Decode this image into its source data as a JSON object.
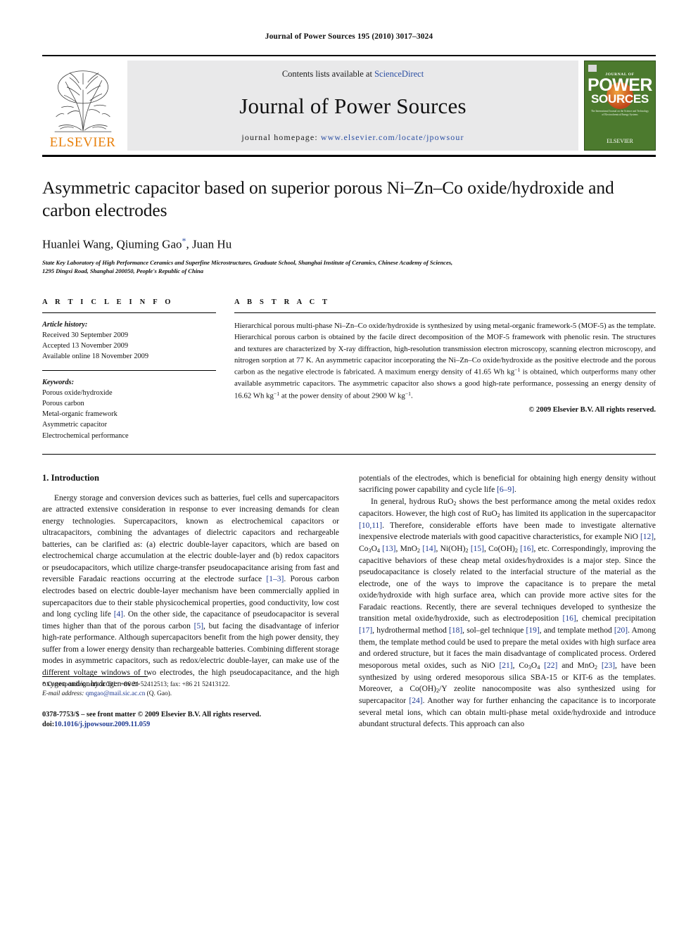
{
  "running_head": "Journal of Power Sources 195 (2010) 3017–3024",
  "masthead": {
    "contents_prefix": "Contents lists available at ",
    "contents_link": "ScienceDirect",
    "journal_title": "Journal of Power Sources",
    "homepage_prefix": "journal homepage: ",
    "homepage_url": "www.elsevier.com/locate/jpowsour",
    "publisher_name": "ELSEVIER",
    "cover": {
      "top_label": "JOURNAL OF",
      "line1": "POWER",
      "line2": "SOURCES",
      "blurb": "The International Journal on the Science and Technology of Electrochemical Energy Systems",
      "bottom_mark": "ELSEVIER"
    }
  },
  "article": {
    "title": "Asymmetric capacitor based on superior porous Ni–Zn–Co oxide/hydroxide and carbon electrodes",
    "authors": "Huanlei Wang, Qiuming Gao",
    "authors_tail": ", Juan Hu",
    "corresponding_mark": "*",
    "affiliation_line1": "State Key Laboratory of High Performance Ceramics and Superfine Microstructures, Graduate School, Shanghai Institute of Ceramics, Chinese Academy of Sciences,",
    "affiliation_line2": "1295 Dingxi Road, Shanghai 200050, People's Republic of China"
  },
  "article_info": {
    "heading": "A R T I C L E    I N F O",
    "history_title": "Article history:",
    "history": [
      "Received 30 September 2009",
      "Accepted 13 November 2009",
      "Available online 18 November 2009"
    ],
    "keywords_title": "Keywords:",
    "keywords": [
      "Porous oxide/hydroxide",
      "Porous carbon",
      "Metal-organic framework",
      "Asymmetric capacitor",
      "Electrochemical performance"
    ]
  },
  "abstract": {
    "heading": "A B S T R A C T",
    "text_part1": "Hierarchical porous multi-phase Ni–Zn–Co oxide/hydroxide is synthesized by using metal-organic framework-5 (MOF-5) as the template. Hierarchical porous carbon is obtained by the facile direct decomposition of the MOF-5 framework with phenolic resin. The structures and textures are characterized by X-ray diffraction, high-resolution transmission electron microscopy, scanning electron microscopy, and nitrogen sorption at 77 K. An asymmetric capacitor incorporating the Ni–Zn–Co oxide/hydroxide as the positive electrode and the porous carbon as the negative electrode is fabricated. A maximum energy density of 41.65 Wh kg",
    "sup1": "−1",
    "text_part2": " is obtained, which outperforms many other available asymmetric capacitors. The asymmetric capacitor also shows a good high-rate performance, possessing an energy density of 16.62 Wh kg",
    "sup2": "−1",
    "text_part3": " at the power density of about 2900 W kg",
    "sup3": "−1",
    "text_part4": ".",
    "copyright": "© 2009 Elsevier B.V. All rights reserved."
  },
  "introduction": {
    "heading": "1.  Introduction",
    "left": {
      "p1_a": "Energy storage and conversion devices such as batteries, fuel cells and supercapacitors are attracted extensive consideration in response to ever increasing demands for clean energy technologies. Supercapacitors, known as electrochemical capacitors or ultracapacitors, combining the advantages of dielectric capacitors and rechargeable batteries, can be clarified as: (a) electric double-layer capacitors, which are based on electrochemical charge accumulation at the electric double-layer and (b) redox capacitors or pseudocapacitors, which utilize charge-transfer pseudocapacitance arising from fast and reversible Faradaic reactions occurring at the electrode surface ",
      "ref1": "[1–3]",
      "p1_b": ". Porous carbon electrodes based on electric double-layer mechanism have been commercially applied in supercapacitors due to their stable physicochemical properties, good conductivity, low cost and long cycling life ",
      "ref2": "[4]",
      "p1_c": ". On the other side, the capacitance of pseudocapacitor is several times higher than that of the porous carbon ",
      "ref3": "[5]",
      "p1_d": ", but facing the disadvantage of inferior high-rate performance. Although supercapacitors benefit from the high power density, they suffer from a lower energy density than rechargeable batteries. Combining different storage modes in asymmetric capacitors, such as redox/electric double-layer, can make use of the different voltage windows of two electrodes, the high pseudocapacitance, and the high oxygen and/or hydrogen over-"
    },
    "right": {
      "p1_a": "potentials of the electrodes, which is beneficial for obtaining high energy density without sacrificing power capability and cycle life ",
      "ref1": "[6–9]",
      "p1_b": ".",
      "p2_a": "In general, hydrous RuO",
      "sub1": "2",
      "p2_b": " shows the best performance among the metal oxides redox capacitors. However, the high cost of RuO",
      "sub2": "2",
      "p2_c": " has limited its application in the supercapacitor ",
      "ref2": "[10,11]",
      "p2_d": ". Therefore, considerable efforts have been made to investigate alternative inexpensive electrode materials with good capacitive characteristics, for example NiO ",
      "ref3": "[12]",
      "p2_e": ", Co",
      "sub3": "3",
      "p2_f": "O",
      "sub4": "4",
      "p2_g": " ",
      "ref4": "[13]",
      "p2_h": ", MnO",
      "sub5": "2",
      "p2_i": " ",
      "ref5": "[14]",
      "p2_j": ", Ni(OH)",
      "sub6": "2",
      "p2_k": " ",
      "ref6": "[15]",
      "p2_l": ", Co(OH)",
      "sub7": "2",
      "p2_m": " ",
      "ref7": "[16]",
      "p2_n": ", etc. Correspondingly, improving the capacitive behaviors of these cheap metal oxides/hydroxides is a major step. Since the pseudocapacitance is closely related to the interfacial structure of the material as the electrode, one of the ways to improve the capacitance is to prepare the metal oxide/hydroxide with high surface area, which can provide more active sites for the Faradaic reactions. Recently, there are several techniques developed to synthesize the transition metal oxide/hydroxide, such as electrodeposition ",
      "ref8": "[16]",
      "p2_o": ", chemical precipitation ",
      "ref9": "[17]",
      "p2_p": ", hydrothermal method ",
      "ref10": "[18]",
      "p2_q": ", sol–gel technique ",
      "ref11": "[19]",
      "p2_r": ", and template method ",
      "ref12": "[20]",
      "p2_s": ". Among them, the template method could be used to prepare the metal oxides with high surface area and ordered structure, but it faces the main disadvantage of complicated process. Ordered mesoporous metal oxides, such as NiO ",
      "ref13": "[21]",
      "p2_t": ", Co",
      "sub8": "3",
      "p2_u": "O",
      "sub9": "4",
      "p2_v": " ",
      "ref14": "[22]",
      "p2_w": " and MnO",
      "sub10": "2",
      "p2_x": " ",
      "ref15": "[23]",
      "p2_y": ", have been synthesized by using ordered mesoporous silica SBA-15 or KIT-6 as the templates. Moreover, a Co(OH)",
      "sub11": "2",
      "p2_z": "/Y zeolite nanocomposite was also synthesized using for supercapacitor ",
      "ref16": "[24]",
      "p2_aa": ". Another way for further enhancing the capacitance is to incorporate several metal ions, which can obtain multi-phase metal oxide/hydroxide and introduce abundant structural defects. This approach can also"
    }
  },
  "footnote": {
    "line1": "*  Corresponding author. Tel.: +86 21 52412513; fax: +86 21 52413122.",
    "line2_label": "E-mail address:",
    "line2_mail": " qmgao@mail.sic.ac.cn",
    "line2_tail": " (Q. Gao).",
    "issn_line": "0378-7753/$ – see front matter © 2009 Elsevier B.V. All rights reserved.",
    "doi_label": "doi:",
    "doi_value": "10.1016/j.jpowsour.2009.11.059"
  },
  "colors": {
    "link": "#2b4ea2",
    "ref": "#1f3a93",
    "elsevier_orange": "#E8800C",
    "cover_green": "#4c7a2e",
    "masthead_gray": "#e9e9ea"
  }
}
